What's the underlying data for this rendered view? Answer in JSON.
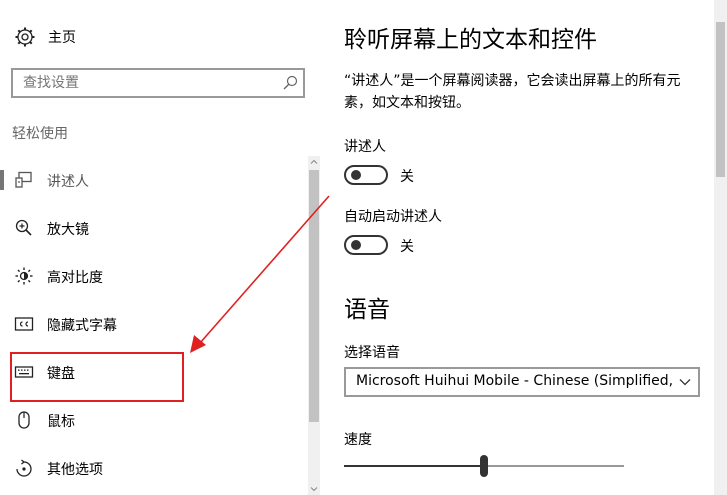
{
  "sidebar": {
    "home_label": "主页",
    "search_placeholder": "查找设置",
    "section_title": "轻松使用",
    "items": [
      {
        "label": "讲述人",
        "icon": "narrator-icon",
        "selected": true
      },
      {
        "label": "放大镜",
        "icon": "magnifier-icon"
      },
      {
        "label": "高对比度",
        "icon": "high-contrast-icon"
      },
      {
        "label": "隐藏式字幕",
        "icon": "closed-captions-icon"
      },
      {
        "label": "键盘",
        "icon": "keyboard-icon"
      },
      {
        "label": "鼠标",
        "icon": "mouse-icon"
      },
      {
        "label": "其他选项",
        "icon": "other-options-icon"
      }
    ]
  },
  "main": {
    "title": "聆听屏幕上的文本和控件",
    "description": "“讲述人”是一个屏幕阅读器，它会读出屏幕上的所有元素，如文本和按钮。",
    "narrator": {
      "label": "讲述人",
      "state": "关",
      "on": false
    },
    "autostart": {
      "label": "自动启动讲述人",
      "state": "关",
      "on": false
    },
    "voice_section_title": "语音",
    "choose_voice_label": "选择语音",
    "voice_selected": "Microsoft Huihui Mobile - Chinese (Simplified, PRC)",
    "speed_label": "速度",
    "speed_value_fraction": 0.5
  },
  "annotation": {
    "highlight_color": "#e02020",
    "target": "keyboard"
  },
  "colors": {
    "accent": "#333333",
    "annotation": "#e02020"
  }
}
